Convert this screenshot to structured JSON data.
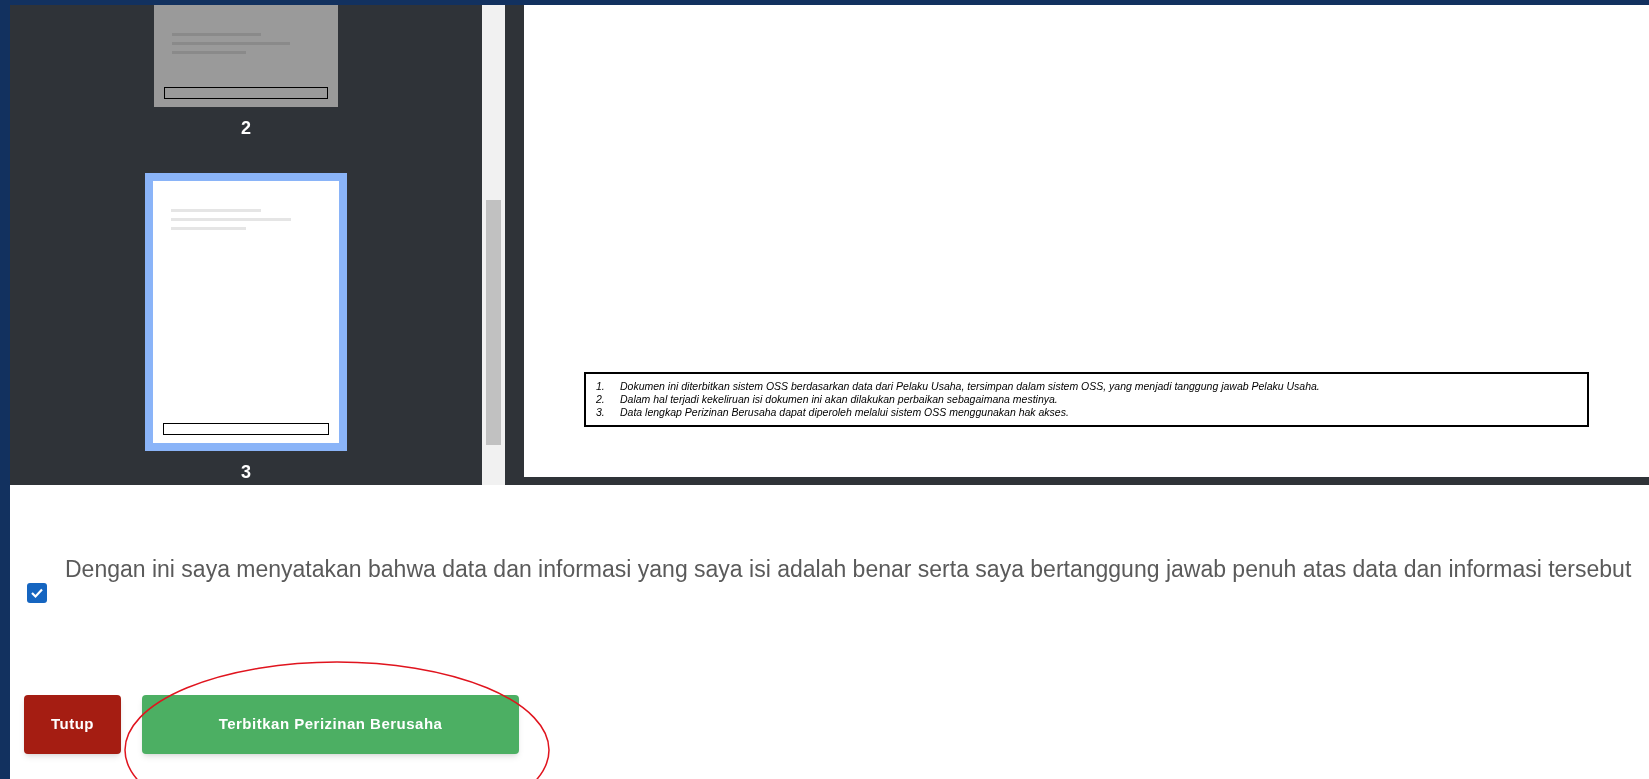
{
  "thumbnails": [
    {
      "label": "2",
      "selected": false
    },
    {
      "label": "3",
      "selected": true
    }
  ],
  "document": {
    "notes": [
      {
        "number": "1.",
        "text": "Dokumen ini diterbitkan sistem OSS berdasarkan data dari Pelaku Usaha, tersimpan dalam sistem OSS, yang menjadi tanggung jawab Pelaku Usaha."
      },
      {
        "number": "2.",
        "text": "Dalam hal terjadi kekeliruan isi dokumen ini akan dilakukan perbaikan sebagaimana mestinya."
      },
      {
        "number": "3.",
        "text": "Data lengkap Perizinan Berusaha dapat diperoleh melalui sistem OSS menggunakan hak akses."
      }
    ]
  },
  "agreement": {
    "checked": true,
    "text": "Dengan ini saya menyatakan bahwa data dan informasi yang saya isi adalah benar serta saya bertanggung jawab penuh atas data dan informasi tersebut"
  },
  "buttons": [
    {
      "label": "Tutup",
      "kind": "danger"
    },
    {
      "label": "Terbitkan Perizinan Berusaha",
      "kind": "success",
      "highlighted": true
    }
  ]
}
